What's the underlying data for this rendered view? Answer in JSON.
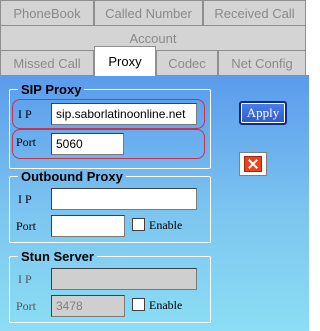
{
  "tabs": {
    "phonebook": "PhoneBook",
    "called_number": "Called Number",
    "received_call": "Received Call",
    "account": "Account",
    "missed_call": "Missed Call",
    "proxy": "Proxy",
    "codec": "Codec",
    "net_config": "Net Config"
  },
  "sip_proxy": {
    "title": "SIP Proxy",
    "ip_label": "I P",
    "ip_value": "sip.saborlatinoonline.net",
    "port_label": "Port",
    "port_value": "5060"
  },
  "outbound_proxy": {
    "title": "Outbound Proxy",
    "ip_label": "I P",
    "ip_value": "",
    "port_label": "Port",
    "port_value": "",
    "enable_label": "Enable",
    "enabled": false
  },
  "stun_server": {
    "title": "Stun Server",
    "ip_label": "I P",
    "ip_value": "",
    "port_label": "Port",
    "port_value": "3478",
    "enable_label": "Enable",
    "enabled": false
  },
  "actions": {
    "apply_label": "Apply",
    "close_icon": "close-icon"
  },
  "colors": {
    "highlight": "#c8324a",
    "panel_top": "#5a9bec",
    "panel_bottom": "#8bdef4",
    "close_red": "#e8451e"
  }
}
